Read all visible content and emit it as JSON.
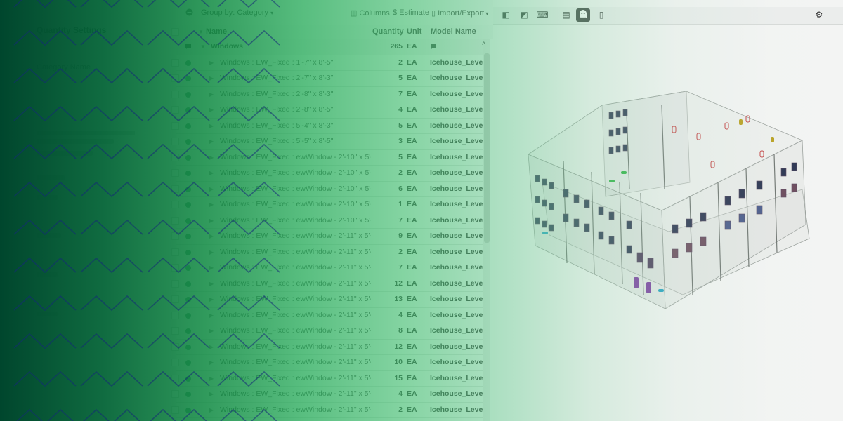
{
  "sidebar": {
    "title": "Quantity Settings",
    "subtitle": "Category Name"
  },
  "toolbar": {
    "group_by": "Group by: Category",
    "columns": "Columns",
    "estimate": "$ Estimate",
    "import_export": "Import/Export"
  },
  "columns": {
    "name": "Name",
    "quantity": "Quantity",
    "unit": "Unit",
    "model": "Model Name"
  },
  "group_row": {
    "name": "Windows",
    "quantity": "265",
    "unit": "EA"
  },
  "rows": [
    {
      "name": "Windows : EW_Fixed : 1'-7\" x 8'-5\"",
      "qty": "2",
      "unit": "EA",
      "model": "Icehouse_Level"
    },
    {
      "name": "Windows : EW_Fixed : 2'-7\" x 8'-3\"",
      "qty": "5",
      "unit": "EA",
      "model": "Icehouse_Level"
    },
    {
      "name": "Windows : EW_Fixed : 2'-8\" x 8'-3\"",
      "qty": "7",
      "unit": "EA",
      "model": "Icehouse_Level"
    },
    {
      "name": "Windows : EW_Fixed : 2'-8\" x 8'-5\"",
      "qty": "4",
      "unit": "EA",
      "model": "Icehouse_Level"
    },
    {
      "name": "Windows : EW_Fixed : 5'-4\" x 8'-3\"",
      "qty": "5",
      "unit": "EA",
      "model": "Icehouse_Level"
    },
    {
      "name": "Windows : EW_Fixed : 5'-5\" x 8'-5\"",
      "qty": "3",
      "unit": "EA",
      "model": "Icehouse_Level"
    },
    {
      "name": "Windows : EW_Fixed : ewWindow - 2'-10\" x 5'-1\"",
      "qty": "5",
      "unit": "EA",
      "model": "Icehouse_Level"
    },
    {
      "name": "Windows : EW_Fixed : ewWindow - 2'-10\" x 5'-2\"",
      "qty": "2",
      "unit": "EA",
      "model": "Icehouse_Level"
    },
    {
      "name": "Windows : EW_Fixed : ewWindow - 2'-10\" x 5'-2\"",
      "qty": "6",
      "unit": "EA",
      "model": "Icehouse_Level"
    },
    {
      "name": "Windows : EW_Fixed : ewWindow - 2'-10\" x 5'-3\"",
      "qty": "1",
      "unit": "EA",
      "model": "Icehouse_Level"
    },
    {
      "name": "Windows : EW_Fixed : ewWindow - 2'-10\" x 5'-4\"",
      "qty": "7",
      "unit": "EA",
      "model": "Icehouse_Level"
    },
    {
      "name": "Windows : EW_Fixed : ewWindow - 2'-11\" x 5'-1\"",
      "qty": "9",
      "unit": "EA",
      "model": "Icehouse_Level"
    },
    {
      "name": "Windows : EW_Fixed : ewWindow - 2'-11\" x 5'-2\"",
      "qty": "2",
      "unit": "EA",
      "model": "Icehouse_Level"
    },
    {
      "name": "Windows : EW_Fixed : ewWindow - 2'-11\" x 5'-2\"",
      "qty": "7",
      "unit": "EA",
      "model": "Icehouse_Level"
    },
    {
      "name": "Windows : EW_Fixed : ewWindow - 2'-11\" x 5'-2\"",
      "qty": "12",
      "unit": "EA",
      "model": "Icehouse_Level"
    },
    {
      "name": "Windows : EW_Fixed : ewWindow - 2'-11\" x 5'-3\"",
      "qty": "13",
      "unit": "EA",
      "model": "Icehouse_Level"
    },
    {
      "name": "Windows : EW_Fixed : ewWindow - 2'-11\" x 5'-3\"",
      "qty": "4",
      "unit": "EA",
      "model": "Icehouse_Level"
    },
    {
      "name": "Windows : EW_Fixed : ewWindow - 2'-11\" x 5'-3\"",
      "qty": "8",
      "unit": "EA",
      "model": "Icehouse_Level"
    },
    {
      "name": "Windows : EW_Fixed : ewWindow - 2'-11\" x 5'-3\"",
      "qty": "12",
      "unit": "EA",
      "model": "Icehouse_Level"
    },
    {
      "name": "Windows : EW_Fixed : ewWindow - 2'-11\" x 5'-4\"",
      "qty": "10",
      "unit": "EA",
      "model": "Icehouse_Level"
    },
    {
      "name": "Windows : EW_Fixed : ewWindow - 2'-11\" x 5'-4\"",
      "qty": "15",
      "unit": "EA",
      "model": "Icehouse_Level"
    },
    {
      "name": "Windows : EW_Fixed : ewWindow - 2'-11\" x 5'-5\"",
      "qty": "4",
      "unit": "EA",
      "model": "Icehouse_Level"
    },
    {
      "name": "Windows : EW_Fixed : ewWindow - 2'-11\" x 5'-6\"",
      "qty": "2",
      "unit": "EA",
      "model": "Icehouse_Level"
    },
    {
      "name": "Windows : EW_Fixed : ewWindow - 2'-8\" x 5'-0\"",
      "qty": "3",
      "unit": "EA",
      "model": "Icehouse_Level"
    }
  ],
  "icons": {
    "collapse": "minus-circle-icon",
    "columns": "columns-icon",
    "import_export": "document-icon",
    "comment": "comment-icon",
    "settings": "gear-icon"
  },
  "colors": {
    "overlay_dark": "#00462d",
    "overlay_mid": "#2daf5f",
    "accent_dot": "#4a8a6a"
  }
}
